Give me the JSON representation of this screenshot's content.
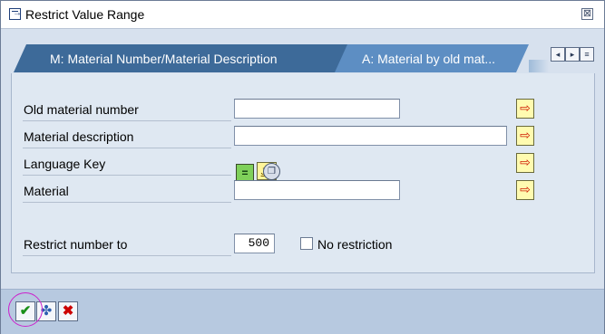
{
  "window": {
    "title": "Restrict Value Range",
    "close_symbol": "⊠"
  },
  "tabs": [
    {
      "label": "M: Material Number/Material Description",
      "active": false
    },
    {
      "label": "A: Material by old mat...",
      "active": true
    }
  ],
  "tab_nav": {
    "prev_symbol": "◂",
    "next_symbol": "▸",
    "list_symbol": "≡"
  },
  "form": {
    "fields": [
      {
        "label": "Old material number",
        "value": ""
      },
      {
        "label": "Material description",
        "value": ""
      },
      {
        "label": "Language Key",
        "operator_symbol": "=",
        "value_display": "JA"
      },
      {
        "label": "Material",
        "value": ""
      }
    ],
    "restrict": {
      "label": "Restrict number to",
      "value": "500",
      "no_restriction_label": "No restriction",
      "no_restriction_checked": false
    }
  },
  "icons": {
    "multiple_selection": "arrow-right-icon",
    "operator": "equals-icon",
    "language_match": "ja-icon",
    "search_help": "search-help-icon",
    "confirm": "checkmark-icon",
    "extend": "extend-search-icon",
    "cancel": "cancel-icon"
  },
  "colors": {
    "active_tab": "#5d8ec3",
    "inactive_tab": "#3d6a99",
    "arrow_button_bg": "#fffbb0",
    "confirm_green": "#1a8f1a",
    "cancel_red": "#cc0000",
    "highlight_circle": "#cc22cc"
  }
}
